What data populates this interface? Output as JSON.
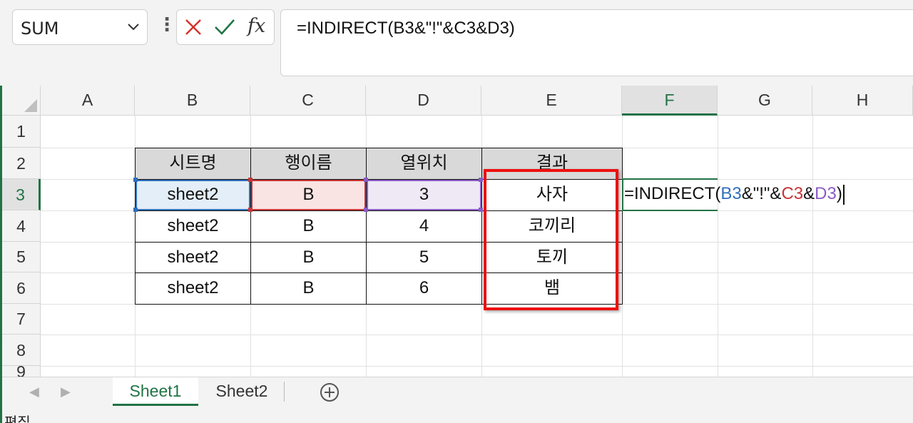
{
  "formula_bar": {
    "name_box": "SUM",
    "formula": "=INDIRECT(B3&\"!\"&C3&D3)"
  },
  "columns": [
    "A",
    "B",
    "C",
    "D",
    "E",
    "F",
    "G",
    "H"
  ],
  "rows": [
    "1",
    "2",
    "3",
    "4",
    "5",
    "6",
    "7",
    "8",
    "9"
  ],
  "table": {
    "headers": [
      "시트명",
      "행이름",
      "열위치",
      "결과"
    ],
    "rows": [
      [
        "sheet2",
        "B",
        "3",
        "사자"
      ],
      [
        "sheet2",
        "B",
        "4",
        "코끼리"
      ],
      [
        "sheet2",
        "B",
        "5",
        "토끼"
      ],
      [
        "sheet2",
        "B",
        "6",
        "뱀"
      ]
    ]
  },
  "edit_cell": {
    "parts": [
      "=INDIRECT(",
      "B3",
      "&\"!\"&",
      "C3",
      "&",
      "D3",
      ")"
    ],
    "colors": {
      "b_ref": "#2f6fba",
      "c_ref": "#c83535",
      "d_ref": "#8a5cc4"
    }
  },
  "sheet_tabs": [
    "Sheet1",
    "Sheet2"
  ],
  "status": "편집",
  "colors": {
    "accent": "#217346",
    "highlight_box": "#ee0f0f"
  }
}
